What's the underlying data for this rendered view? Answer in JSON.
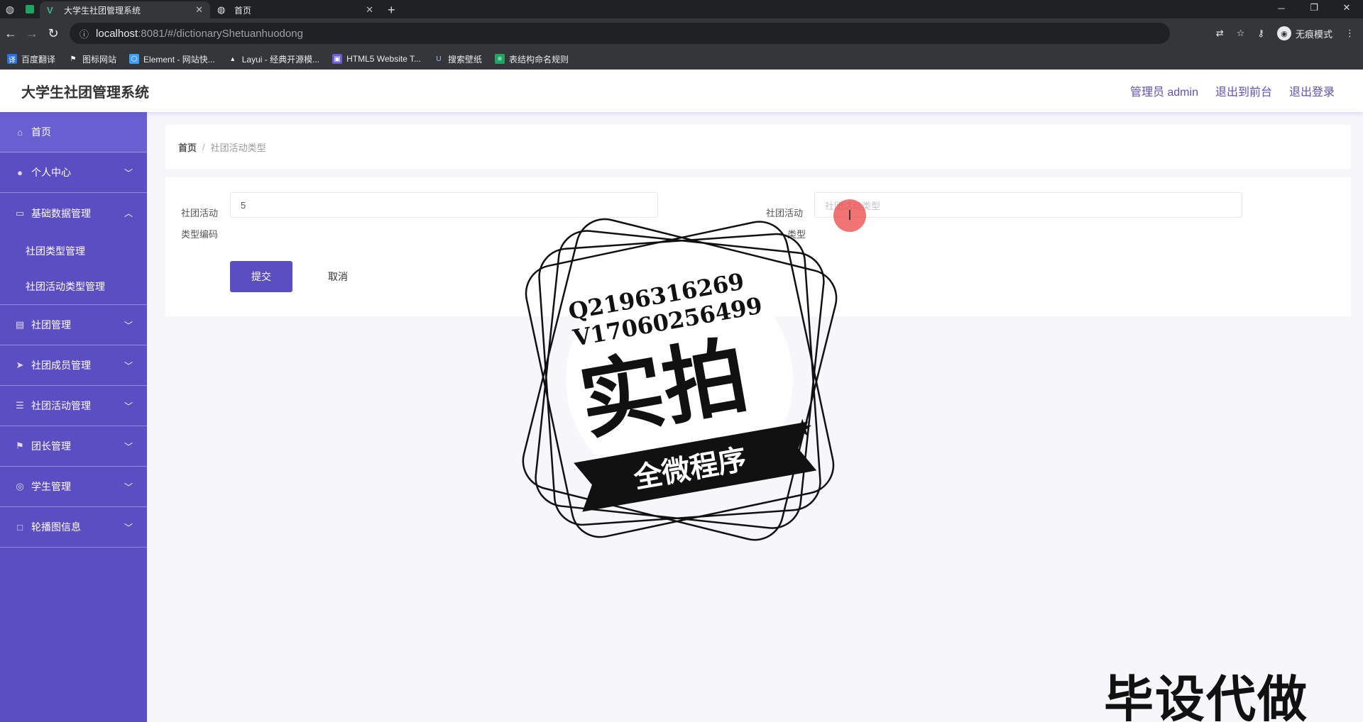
{
  "browser": {
    "tabs": [
      {
        "label": "大学生社团管理系统",
        "icon": "vue-icon",
        "active": true
      },
      {
        "label": "首页",
        "icon": "globe-icon",
        "active": false
      }
    ],
    "url_host": "localhost",
    "url_path": ":8081/#/dictionaryShetuanhuodong",
    "incognito_label": "无痕模式",
    "bookmarks": [
      "百度翻译",
      "图标网站",
      "Element - 网站快...",
      "Layui - 经典开源模...",
      "HTML5 Website T...",
      "搜索壁纸",
      "表结构命名规则"
    ]
  },
  "header": {
    "title": "大学生社团管理系统",
    "admin_label": "管理员 admin",
    "back_front_label": "退出到前台",
    "logout_label": "退出登录"
  },
  "sidebar": {
    "items": [
      {
        "label": "首页",
        "icon": "home-icon"
      },
      {
        "label": "个人中心",
        "icon": "user-icon"
      },
      {
        "label": "基础数据管理",
        "icon": "data-icon",
        "expanded": true,
        "children": [
          "社团类型管理",
          "社团活动类型管理"
        ]
      },
      {
        "label": "社团管理",
        "icon": "club-icon"
      },
      {
        "label": "社团成员管理",
        "icon": "send-icon"
      },
      {
        "label": "社团活动管理",
        "icon": "activity-icon"
      },
      {
        "label": "团长管理",
        "icon": "flag-icon"
      },
      {
        "label": "学生管理",
        "icon": "student-icon"
      },
      {
        "label": "轮播图信息",
        "icon": "image-icon"
      }
    ]
  },
  "breadcrumb": {
    "home": "首页",
    "current": "社团活动类型"
  },
  "form": {
    "field1_label_line1": "社团活动",
    "field1_label_line2": "类型编码",
    "field1_value": "5",
    "field2_label_line1": "社团活动",
    "field2_label_line2": "类型",
    "field2_placeholder": "社团活动类型",
    "submit_label": "提交",
    "cancel_label": "取消"
  },
  "overlay": {
    "stamp_line1": "Q2196316269",
    "stamp_line2": "V17060256499",
    "stamp_big": "实拍",
    "stamp_banner": "全微程序",
    "bottom_text": "毕设代做"
  },
  "colors": {
    "accent": "#5b4ec2",
    "link": "#5a53b6"
  }
}
